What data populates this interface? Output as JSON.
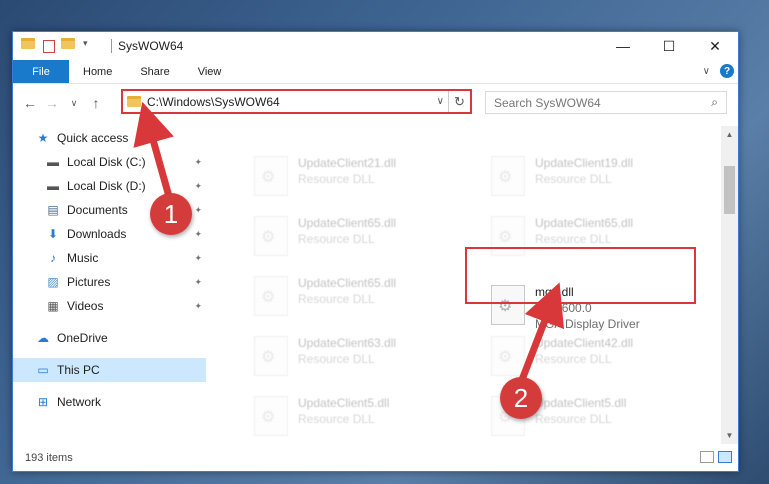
{
  "window": {
    "title": "SysWOW64",
    "minimize_glyph": "—",
    "maximize_glyph": "☐",
    "close_glyph": "✕"
  },
  "ribbon": {
    "tabs": [
      "File",
      "Home",
      "Share",
      "View"
    ],
    "expand_glyph": "∨",
    "help_glyph": "?"
  },
  "navigation": {
    "back_glyph": "←",
    "forward_glyph": "→",
    "recent_glyph": "∨",
    "up_glyph": "↑"
  },
  "address": {
    "path": "C:\\Windows\\SysWOW64",
    "dropdown_glyph": "∨",
    "refresh_glyph": "↻"
  },
  "search": {
    "placeholder": "Search SysWOW64",
    "icon": "search-icon"
  },
  "sidebar": {
    "items": [
      {
        "label": "Quick access",
        "icon": "star-icon",
        "glyph": "★",
        "color": "#2a7ad5",
        "pinned": false
      },
      {
        "label": "Local Disk (C:)",
        "icon": "drive-icon",
        "glyph": "▬",
        "color": "#555555",
        "pinned": true
      },
      {
        "label": "Local Disk (D:)",
        "icon": "drive-icon",
        "glyph": "▬",
        "color": "#555555",
        "pinned": true
      },
      {
        "label": "Documents",
        "icon": "documents-icon",
        "glyph": "▤",
        "color": "#4a6a90",
        "pinned": true
      },
      {
        "label": "Downloads",
        "icon": "downloads-icon",
        "glyph": "⬇",
        "color": "#2a7ad5",
        "pinned": true
      },
      {
        "label": "Music",
        "icon": "music-icon",
        "glyph": "♪",
        "color": "#2a7ad5",
        "pinned": true
      },
      {
        "label": "Pictures",
        "icon": "pictures-icon",
        "glyph": "▨",
        "color": "#4a8ac5",
        "pinned": true
      },
      {
        "label": "Videos",
        "icon": "videos-icon",
        "glyph": "▦",
        "color": "#555555",
        "pinned": true
      },
      {
        "label": "OneDrive",
        "icon": "onedrive-icon",
        "glyph": "☁",
        "color": "#2a7ad5",
        "pinned": false
      },
      {
        "label": "This PC",
        "icon": "computer-icon",
        "glyph": "▭",
        "color": "#2a7ad5",
        "pinned": false,
        "selected": true
      },
      {
        "label": "Network",
        "icon": "network-icon",
        "glyph": "⊞",
        "color": "#2a7ad5",
        "pinned": false
      }
    ],
    "pin_glyph": "📌"
  },
  "files": [
    {
      "name": "UpdateClient21.dll",
      "sub": "Resource DLL",
      "faded": true
    },
    {
      "name": "UpdateClient19.dll",
      "sub": "Resource DLL",
      "faded": true
    },
    {
      "name": "UpdateClient65.dll",
      "sub": "Resource DLL",
      "faded": true
    },
    {
      "name": "UpdateClient65.dll",
      "sub": "Resource DLL",
      "faded": true
    },
    {
      "name": "UpdateClient65.dll",
      "sub": "Resource DLL",
      "faded": true
    },
    {
      "name": "mga.dll",
      "version": "5.1.2600.0",
      "sub": "MGA Display Driver",
      "faded": false
    },
    {
      "name": "UpdateClient63.dll",
      "sub": "Resource DLL",
      "faded": true
    },
    {
      "name": "UpdateClient42.dll",
      "sub": "Resource DLL",
      "faded": true
    },
    {
      "name": "UpdateClient5.dll",
      "sub": "Resource DLL",
      "faded": true
    },
    {
      "name": "UpdateClient5.dll",
      "sub": "Resource DLL",
      "faded": true
    }
  ],
  "status": {
    "item_count": "193 items"
  },
  "annotations": {
    "badge_1": "1",
    "badge_2": "2",
    "accent_color": "#d9383a"
  }
}
